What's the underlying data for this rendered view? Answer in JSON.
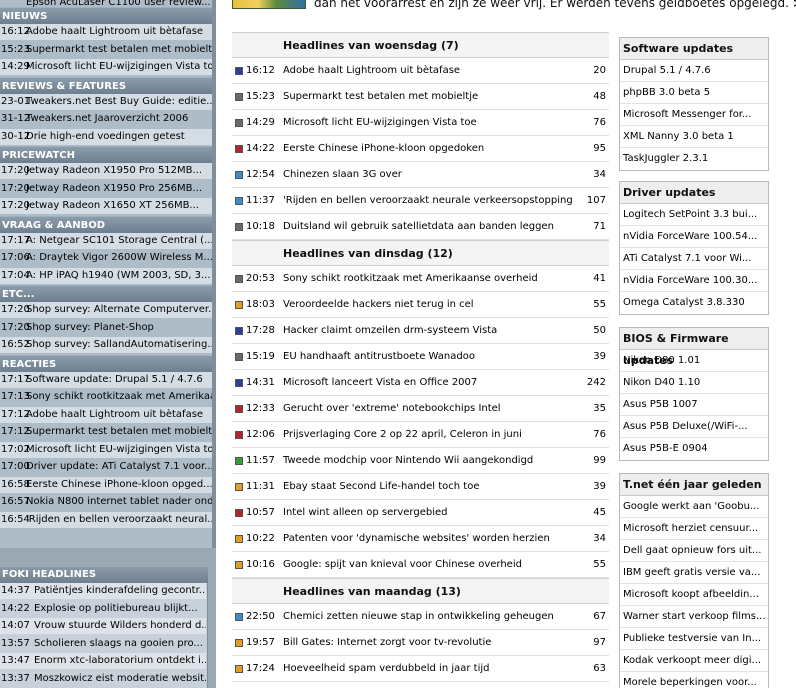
{
  "sidebar": {
    "top_item": {
      "time": "",
      "label": "Epson AcuLaser C1100 user review..."
    },
    "sections": [
      {
        "title": "NIEUWS",
        "items": [
          {
            "time": "16:12",
            "label": "Adobe haalt Lightroom uit bètafase"
          },
          {
            "time": "15:23",
            "label": "Supermarkt test betalen met mobieltje"
          },
          {
            "time": "14:29",
            "label": "Microsoft licht EU-wijzigingen Vista toe"
          }
        ]
      },
      {
        "title": "REVIEWS & FEATURES",
        "items": [
          {
            "time": "23-01",
            "label": "Tweakers.net Best Buy Guide: editie..."
          },
          {
            "time": "31-12",
            "label": "Tweakers.net Jaaroverzicht 2006"
          },
          {
            "time": "30-12",
            "label": "Drie high-end voedingen getest"
          }
        ]
      },
      {
        "title": "PRICEWATCH",
        "items": [
          {
            "time": "17:20",
            "label": "Jetway Radeon X1950 Pro 512MB..."
          },
          {
            "time": "17:20",
            "label": "Jetway Radeon X1950 Pro 256MB..."
          },
          {
            "time": "17:20",
            "label": "Jetway Radeon X1650 XT 256MB..."
          }
        ]
      },
      {
        "title": "VRAAG & AANBOD",
        "items": [
          {
            "time": "17:17",
            "label": "A: Netgear SC101 Storage Central (..."
          },
          {
            "time": "17:06",
            "label": "A: Draytek Vigor 2600W Wireless M..."
          },
          {
            "time": "17:04",
            "label": "A: HP iPAQ h1940 (WM 2003, SD, 3..."
          }
        ]
      },
      {
        "title": "ETC...",
        "items": [
          {
            "time": "17:20",
            "label": "Shop survey: Alternate Computerver..."
          },
          {
            "time": "17:20",
            "label": "Shop survey: Planet-Shop"
          },
          {
            "time": "16:52",
            "label": "Shop survey: SallandAutomatisering..."
          }
        ]
      },
      {
        "title": "REACTIES",
        "items": [
          {
            "time": "17:17",
            "label": "Software update: Drupal 5.1 / 4.7.6"
          },
          {
            "time": "17:13",
            "label": "Sony schikt rootkitzaak met Amerikaa..."
          },
          {
            "time": "17:12",
            "label": "Adobe haalt Lightroom uit bètafase"
          },
          {
            "time": "17:12",
            "label": "Supermarkt test betalen met mobieltje"
          },
          {
            "time": "17:02",
            "label": "Microsoft licht EU-wijzigingen Vista toe"
          },
          {
            "time": "17:00",
            "label": "Driver update: ATi Catalyst 7.1 voor..."
          },
          {
            "time": "16:58",
            "label": "Eerste Chinese iPhone-kloon opged..."
          },
          {
            "time": "16:57",
            "label": "Nokia N800 internet tablet nader ond..."
          },
          {
            "time": "16:54",
            "label": "'Rijden en bellen veroorzaakt neural..."
          }
        ]
      }
    ],
    "foki": {
      "title": "FOKI HEADLINES",
      "items": [
        {
          "time": "14:37",
          "label": "Patiëntjes kinderafdeling gecontr..."
        },
        {
          "time": "14:22",
          "label": "Explosie op politiebureau blijkt..."
        },
        {
          "time": "14:07",
          "label": "Vrouw stuurde Wilders honderd d..."
        },
        {
          "time": "13:57",
          "label": "Scholieren slaags na gooien pro..."
        },
        {
          "time": "13:47",
          "label": "Enorm xtc-laboratorium ontdekt i..."
        },
        {
          "time": "13:37",
          "label": "Moszkowicz eist moderatie websit..."
        }
      ]
    }
  },
  "banner": {
    "text": "dan het voorarrest en zijn ze weer vrij. Er werden tevens geldboetes opgelegd.",
    "more": ">>"
  },
  "news": {
    "days": [
      {
        "title": "Headlines van woensdag (7)",
        "items": [
          {
            "time": "16:12",
            "title": "Adobe haalt Lightroom uit bètafase",
            "count": "20",
            "color": "#2a3f9c"
          },
          {
            "time": "15:23",
            "title": "Supermarkt test betalen met mobieltje",
            "count": "48",
            "color": "#6a6a6a"
          },
          {
            "time": "14:29",
            "title": "Microsoft licht EU-wijzigingen Vista toe",
            "count": "76",
            "color": "#6a6a6a"
          },
          {
            "time": "14:22",
            "title": "Eerste Chinese iPhone-kloon opgedoken",
            "count": "95",
            "color": "#b4232a"
          },
          {
            "time": "12:54",
            "title": "Chinezen slaan 3G over",
            "count": "34",
            "color": "#3b8ec9"
          },
          {
            "time": "11:37",
            "title": "'Rijden en bellen veroorzaakt neurale verkeersopstopping'",
            "count": "107",
            "color": "#3b8ec9"
          },
          {
            "time": "10:18",
            "title": "Duitsland wil gebruik satellietdata aan banden leggen",
            "count": "71",
            "color": "#6a6a6a"
          }
        ]
      },
      {
        "title": "Headlines van dinsdag (12)",
        "items": [
          {
            "time": "20:53",
            "title": "Sony schikt rootkitzaak met Amerikaanse overheid",
            "count": "41",
            "color": "#6a6a6a"
          },
          {
            "time": "18:03",
            "title": "Veroordeelde hackers niet terug in cel",
            "count": "55",
            "color": "#e39b22"
          },
          {
            "time": "17:28",
            "title": "Hacker claimt omzeilen drm-systeem Vista",
            "count": "50",
            "color": "#2a3f9c"
          },
          {
            "time": "15:19",
            "title": "EU handhaaft antitrustboete Wanadoo",
            "count": "39",
            "color": "#6a6a6a"
          },
          {
            "time": "14:31",
            "title": "Microsoft lanceert Vista en Office 2007",
            "count": "242",
            "color": "#2a3f9c"
          },
          {
            "time": "12:33",
            "title": "Gerucht over 'extreme' notebookchips Intel",
            "count": "35",
            "color": "#b4232a"
          },
          {
            "time": "12:06",
            "title": "Prijsverlaging Core 2 op 22 april, Celeron in juni",
            "count": "76",
            "color": "#b4232a"
          },
          {
            "time": "11:57",
            "title": "Tweede modchip voor Nintendo Wii aangekondigd",
            "count": "99",
            "color": "#3a9a3a"
          },
          {
            "time": "11:31",
            "title": "Ebay staat Second Life-handel toch toe",
            "count": "39",
            "color": "#e39b22"
          },
          {
            "time": "10:57",
            "title": "Intel wint alleen op servergebied",
            "count": "45",
            "color": "#b4232a"
          },
          {
            "time": "10:22",
            "title": "Patenten voor 'dynamische websites' worden herzien",
            "count": "34",
            "color": "#e39b22"
          },
          {
            "time": "10:16",
            "title": "Google: spijt van knieval voor Chinese overheid",
            "count": "55",
            "color": "#e39b22"
          }
        ]
      },
      {
        "title": "Headlines van maandag (13)",
        "items": [
          {
            "time": "22:50",
            "title": "Chemici zetten nieuwe stap in ontwikkeling geheugen",
            "count": "67",
            "color": "#3b8ec9"
          },
          {
            "time": "19:57",
            "title": "Bill Gates: Internet zorgt voor tv-revolutie",
            "count": "97",
            "color": "#e39b22"
          },
          {
            "time": "17:24",
            "title": "Hoeveelheid spam verdubbeld in jaar tijd",
            "count": "63",
            "color": "#e39b22"
          }
        ]
      }
    ]
  },
  "right": {
    "boxes": [
      {
        "title": "Software updates",
        "items": [
          "Drupal 5.1 / 4.7.6",
          "phpBB 3.0 beta 5",
          "Microsoft Messenger for...",
          "XML Nanny 3.0 beta 1",
          "TaskJuggler 2.3.1"
        ]
      },
      {
        "title": "Driver updates",
        "items": [
          "Logitech SetPoint 3.3 bui...",
          "nVidia ForceWare 100.54...",
          "ATi Catalyst 7.1 voor Wi...",
          "nVidia ForceWare 100.30...",
          "Omega Catalyst 3.8.330"
        ]
      },
      {
        "title": "BIOS & Firmware updates",
        "items": [
          "Nikon D80 1.01",
          "Nikon D40 1.10",
          "Asus P5B 1007",
          "Asus P5B Deluxe(/WiFi-...",
          "Asus P5B-E 0904"
        ]
      },
      {
        "title": "T.net één jaar geleden",
        "items": [
          "Google werkt aan 'Goobu...",
          "Microsoft herziet censuur...",
          "Dell gaat opnieuw fors uit...",
          "IBM geeft gratis versie va...",
          "Microsoft koopt afbeeldin...",
          "Warner start verkoop films...",
          "Publieke testversie van In...",
          "Kodak verkoopt meer digi...",
          "Morele beperkingen voor..."
        ]
      }
    ]
  }
}
